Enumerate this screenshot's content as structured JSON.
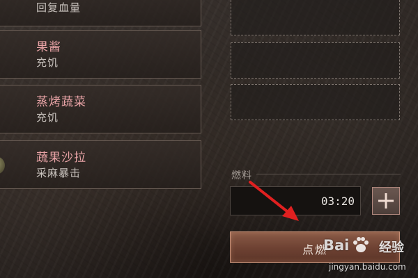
{
  "recipes": [
    {
      "name": "",
      "effect": "回复血量"
    },
    {
      "name": "果酱",
      "effect": "充饥"
    },
    {
      "name": "蒸烤蔬菜",
      "effect": "充饥"
    },
    {
      "name": "蔬果沙拉",
      "effect": "采麻暴击"
    }
  ],
  "fuel": {
    "label": "燃料",
    "time": "03:20",
    "add_icon": "plus-icon"
  },
  "ignite": {
    "label": "点燃"
  },
  "annotation": {
    "arrow_icon": "red-arrow-icon",
    "color": "#e02020"
  },
  "watermark": {
    "logo_prefix": "Bai",
    "brand": "经验",
    "url": "jingyan.baidu.com"
  },
  "colors": {
    "recipe_name": "#e8a3a6",
    "ignite_button": "#7a4a39",
    "ignite_border": "#c48d74"
  }
}
